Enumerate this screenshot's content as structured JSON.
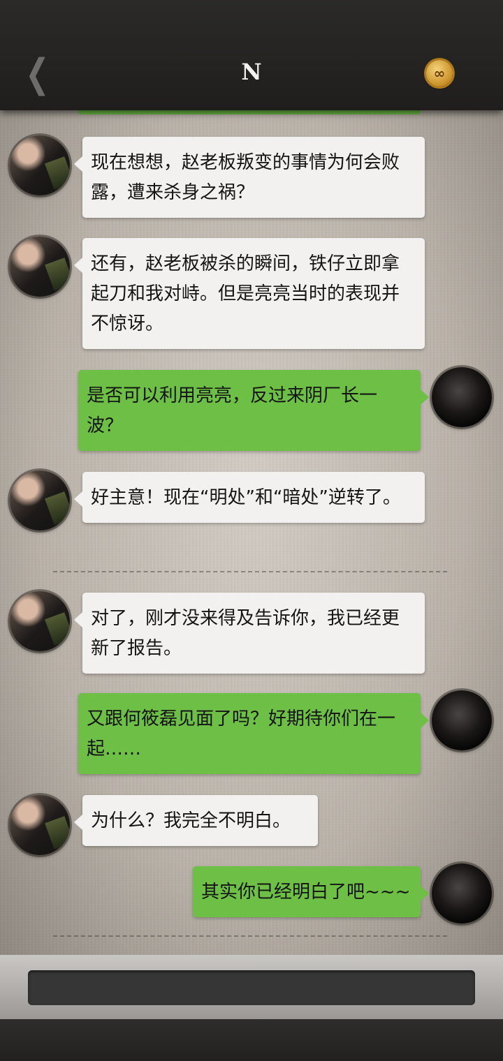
{
  "header": {
    "title": "N",
    "back_icon": "chevron-left-icon",
    "coin_symbol": "∞"
  },
  "messages": [
    {
      "from": "ai",
      "text": "现在想想，赵老板叛变的事情为何会败露，遭来杀身之祸？"
    },
    {
      "from": "ai",
      "text": "还有，赵老板被杀的瞬间，铁仔立即拿起刀和我对峙。但是亮亮当时的表现并不惊讶。"
    },
    {
      "from": "user",
      "text": "是否可以利用亮亮，反过来阴厂长一波？"
    },
    {
      "from": "ai",
      "text": "好主意！现在“明处”和“暗处”逆转了。"
    },
    {
      "from": "ai",
      "text": "对了，刚才没来得及告诉你，我已经更新了报告。"
    },
    {
      "from": "user",
      "text": "又跟何筱磊见面了吗？好期待你们在一起……"
    },
    {
      "from": "ai",
      "text": "为什么？我完全不明白。"
    },
    {
      "from": "user",
      "text": "其实你已经明白了吧~~~"
    }
  ],
  "input": {
    "value": "",
    "placeholder": ""
  },
  "colors": {
    "user_bubble": "#6dbf45",
    "ai_bubble": "#f2f1ef",
    "header_bg": "#2b2a29"
  }
}
